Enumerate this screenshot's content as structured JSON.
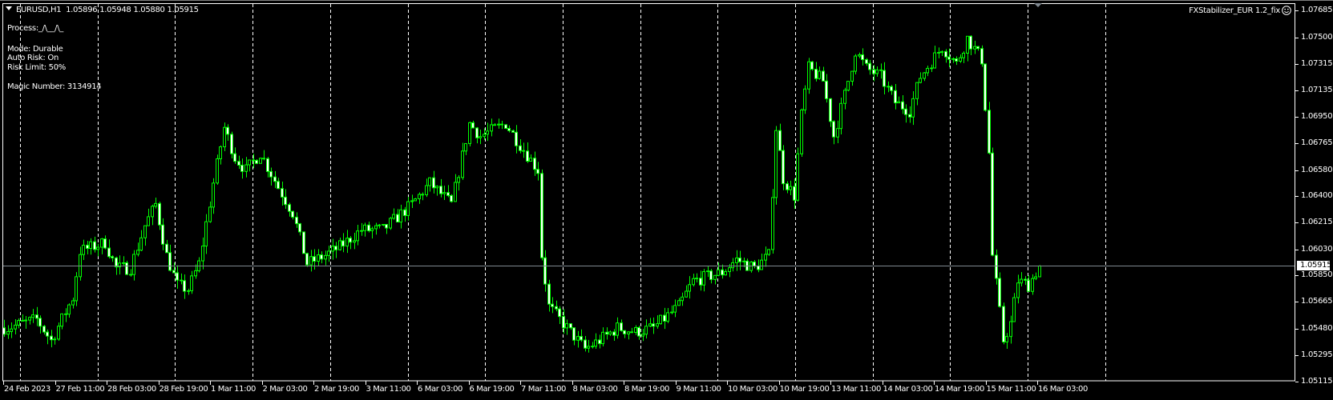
{
  "header": {
    "symbol": "EURUSD,H1",
    "ohlc": "1.05896 1.05948 1.05880 1.05915"
  },
  "panel": {
    "process_label": "Process:",
    "process_signal": "_/\\__/\\_",
    "mode": "Mode: Durable",
    "auto_risk": "Auto Risk: On",
    "risk_limit": "Risk Limit: 50%",
    "magic_number": "Magic Number: 3134914"
  },
  "expert": {
    "name": "FXStabilizer_EUR 1.2_fix",
    "status_icon": "smiley-icon"
  },
  "colors": {
    "background": "#000000",
    "candle": "#00ff00",
    "grid": "#ffffff",
    "price_line": "#808890"
  },
  "chart_data": {
    "type": "candlestick",
    "symbol": "EURUSD",
    "timeframe": "H1",
    "current_price": "1.05915",
    "y_ticks": [
      "1.07685",
      "1.07500",
      "1.07315",
      "1.07135",
      "1.06950",
      "1.06765",
      "1.06580",
      "1.06400",
      "1.06215",
      "1.06030",
      "1.05850",
      "1.05665",
      "1.05480",
      "1.05295",
      "1.05115"
    ],
    "ylim": [
      1.05115,
      1.07685
    ],
    "x_ticks": [
      "24 Feb 2023",
      "27 Feb 11:00",
      "28 Feb 03:00",
      "28 Feb 19:00",
      "1 Mar 11:00",
      "2 Mar 03:00",
      "2 Mar 19:00",
      "3 Mar 11:00",
      "6 Mar 03:00",
      "6 Mar 19:00",
      "7 Mar 11:00",
      "8 Mar 03:00",
      "8 Mar 19:00",
      "9 Mar 11:00",
      "10 Mar 03:00",
      "10 Mar 19:00",
      "13 Mar 11:00",
      "14 Mar 03:00",
      "14 Mar 19:00",
      "15 Mar 11:00",
      "16 Mar 03:00"
    ],
    "bars_count": 288,
    "close_path": [
      [
        1,
        1.05486
      ],
      [
        9,
        1.05545
      ],
      [
        13,
        1.05398
      ],
      [
        19,
        1.05693
      ],
      [
        21,
        1.06018
      ],
      [
        28,
        1.06077
      ],
      [
        31,
        1.059
      ],
      [
        35,
        1.059
      ],
      [
        39,
        1.06195
      ],
      [
        42,
        1.06342
      ],
      [
        45,
        1.05988
      ],
      [
        48,
        1.05782
      ],
      [
        51,
        1.05752
      ],
      [
        54,
        1.0593
      ],
      [
        58,
        1.0649
      ],
      [
        61,
        1.06874
      ],
      [
        64,
        1.06667
      ],
      [
        67,
        1.06579
      ],
      [
        71,
        1.06697
      ],
      [
        76,
        1.06461
      ],
      [
        80,
        1.06283
      ],
      [
        84,
        1.0593
      ],
      [
        89,
        1.05988
      ],
      [
        93,
        1.06047
      ],
      [
        99,
        1.06165
      ],
      [
        105,
        1.06165
      ],
      [
        109,
        1.06254
      ],
      [
        113,
        1.06342
      ],
      [
        118,
        1.0649
      ],
      [
        124,
        1.06342
      ],
      [
        129,
        1.06903
      ],
      [
        132,
        1.06815
      ],
      [
        139,
        1.06903
      ],
      [
        143,
        1.06756
      ],
      [
        148,
        1.06579
      ],
      [
        149,
        1.05988
      ],
      [
        151,
        1.05634
      ],
      [
        156,
        1.05486
      ],
      [
        161,
        1.05339
      ],
      [
        165,
        1.05398
      ],
      [
        170,
        1.05486
      ],
      [
        175,
        1.05457
      ],
      [
        180,
        1.05486
      ],
      [
        187,
        1.05634
      ],
      [
        191,
        1.05811
      ],
      [
        199,
        1.0587
      ],
      [
        203,
        1.05959
      ],
      [
        208,
        1.059
      ],
      [
        212,
        1.05988
      ],
      [
        214,
        1.06874
      ],
      [
        216,
        1.0652
      ],
      [
        219,
        1.06402
      ],
      [
        221,
        1.06962
      ],
      [
        223,
        1.07287
      ],
      [
        227,
        1.07199
      ],
      [
        230,
        1.06815
      ],
      [
        234,
        1.07199
      ],
      [
        236,
        1.07405
      ],
      [
        239,
        1.07287
      ],
      [
        243,
        1.07228
      ],
      [
        247,
        1.07051
      ],
      [
        251,
        1.06992
      ],
      [
        254,
        1.07228
      ],
      [
        260,
        1.07435
      ],
      [
        264,
        1.07317
      ],
      [
        267,
        1.07494
      ],
      [
        271,
        1.07346
      ],
      [
        273,
        1.06697
      ],
      [
        274,
        1.05988
      ],
      [
        277,
        1.05398
      ],
      [
        279,
        1.05516
      ],
      [
        281,
        1.05811
      ],
      [
        284,
        1.05782
      ],
      [
        287,
        1.05915
      ]
    ]
  }
}
